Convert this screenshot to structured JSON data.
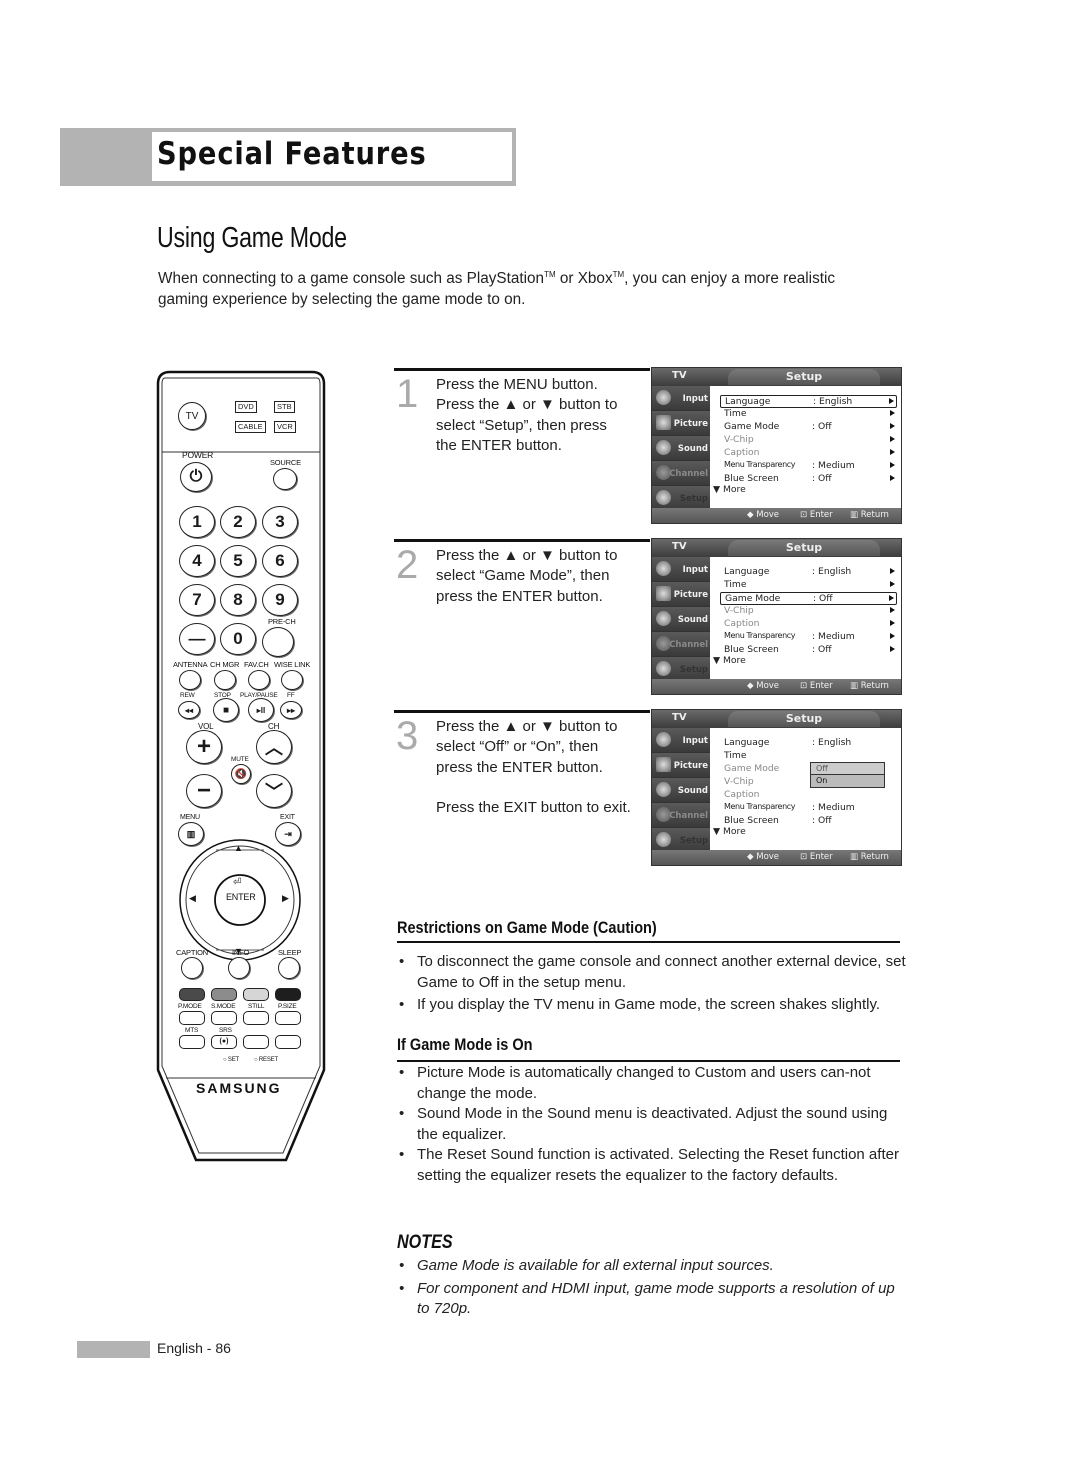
{
  "header": {
    "section": "Special Features"
  },
  "page": {
    "title": "Using Game Mode",
    "intro_parts": [
      "When connecting to a game console such as PlayStation",
      "TM",
      " or Xbox",
      "TM",
      ", you can enjoy a more realistic gaming experience by selecting the game mode to on."
    ]
  },
  "remote": {
    "top_buttons": [
      "TV"
    ],
    "mode_buttons": [
      "DVD",
      "STB",
      "CABLE",
      "VCR"
    ],
    "power_label": "POWER",
    "source_label": "SOURCE",
    "digits": [
      "1",
      "2",
      "3",
      "4",
      "5",
      "6",
      "7",
      "8",
      "9",
      "—",
      "0",
      ""
    ],
    "prech_label": "PRE-CH",
    "row_labels": [
      "ANTENNA",
      "CH MGR",
      "FAV.CH",
      "WISE LINK"
    ],
    "transport_labels": [
      "REW",
      "STOP",
      "PLAY/PAUSE",
      "FF"
    ],
    "transport_glyphs": [
      "◂◂",
      "■",
      "▸II",
      "▸▸"
    ],
    "vol_label": "VOL",
    "ch_label": "CH",
    "mute_label": "MUTE",
    "menu_label": "MENU",
    "exit_label": "EXIT",
    "enter_label": "ENTER",
    "func_labels": [
      "CAPTION",
      "INFO",
      "SLEEP"
    ],
    "color_labels": [
      "P.MODE",
      "S.MODE",
      "STILL",
      "P.SIZE"
    ],
    "bottom_labels": [
      "MTS",
      "SRS"
    ],
    "srs_glyph": "(●)",
    "set_label": "SET",
    "reset_label": "RESET",
    "brand": "SAMSUNG",
    "colors": {
      "red_key": "#4a4a4a",
      "green_key": "#8c8c8c",
      "yellow_key": "#d6d6d6",
      "blue_key": "#1e1e1e"
    }
  },
  "steps": [
    {
      "num": "1",
      "lines": [
        "Press the MENU button.",
        "Press the ▲ or ▼ button to",
        "select “Setup”, then press",
        "the ENTER button."
      ]
    },
    {
      "num": "2",
      "lines": [
        "Press the ▲ or ▼ button to",
        "select “Game Mode”, then",
        "press the ENTER button."
      ]
    },
    {
      "num": "3",
      "lines": [
        "Press the ▲ or ▼ button to",
        "select “Off” or “On”, then",
        "press the ENTER button."
      ],
      "extra": "Press the EXIT button to exit."
    }
  ],
  "tv_menu": {
    "tv_label": "TV",
    "tab": "Setup",
    "sidebar": [
      "Input",
      "Picture",
      "Sound",
      "Channel",
      "Setup"
    ],
    "rows": [
      {
        "label": "Language",
        "value": ": English"
      },
      {
        "label": "Time",
        "value": ""
      },
      {
        "label": "Game Mode",
        "value": ": Off"
      },
      {
        "label": "V-Chip",
        "value": ""
      },
      {
        "label": "Caption",
        "value": ""
      },
      {
        "label": "Menu Transparency",
        "value": ": Medium"
      },
      {
        "label": "Blue Screen",
        "value": ": Off"
      }
    ],
    "more": "▼ More",
    "footer": {
      "move": "◆ Move",
      "enter": "⊡ Enter",
      "return": "▥ Return"
    },
    "dropdown": [
      "Off",
      "On"
    ],
    "screens": [
      {
        "selected_row": "Language"
      },
      {
        "selected_row": "Game Mode"
      },
      {
        "selected_row": "Game Mode",
        "dropdown_open": true
      }
    ]
  },
  "restrictions": {
    "heading": "Restrictions on Game Mode (Caution)",
    "items": [
      "To disconnect the game console and connect another external device, set Game to Off in the setup menu.",
      "If you display the TV menu in Game mode, the screen shakes slightly."
    ]
  },
  "game_mode_on": {
    "heading": "If Game Mode is On",
    "items": [
      "Picture Mode is automatically changed to Custom and users can-not change the mode.",
      "Sound Mode in the Sound menu is deactivated. Adjust the sound using the equalizer.",
      "The Reset Sound function is activated. Selecting the Reset function after setting the equalizer resets the equalizer to the factory defaults."
    ]
  },
  "notes": {
    "heading": "NOTES",
    "items": [
      "Game Mode is available for all external input sources.",
      "For component and HDMI input, game mode supports a resolution of up to 720p."
    ]
  },
  "footer": {
    "page_label": "English - 86"
  }
}
